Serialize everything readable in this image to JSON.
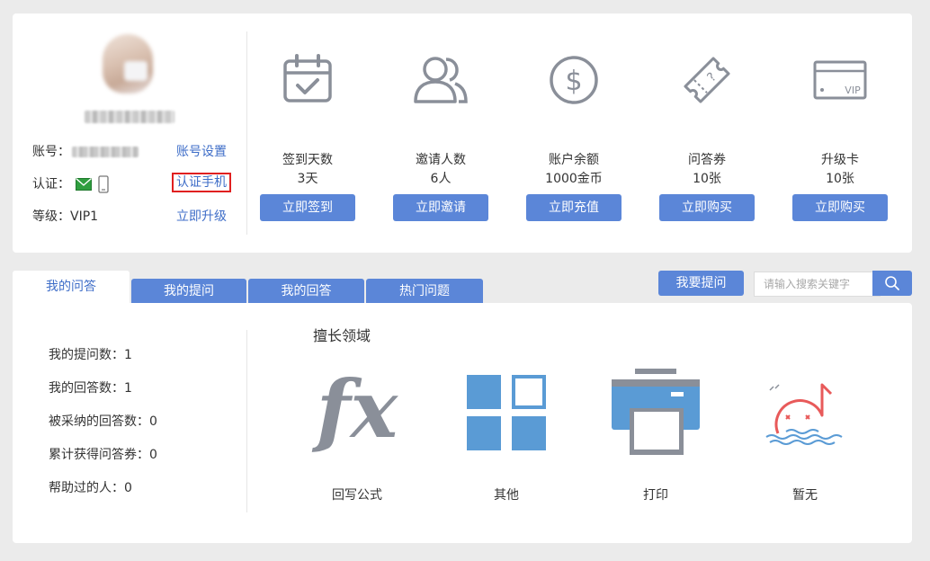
{
  "profile": {
    "account_label": "账号：",
    "verify_label": "认证：",
    "level_label": "等级：VIP1",
    "account_settings_link": "账号设置",
    "verify_phone_link": "认证手机",
    "upgrade_link": "立即升级"
  },
  "stats": [
    {
      "icon": "calendar-check-icon",
      "label": "签到天数",
      "value": "3天",
      "button": "立即签到"
    },
    {
      "icon": "users-icon",
      "label": "邀请人数",
      "value": "6人",
      "button": "立即邀请"
    },
    {
      "icon": "dollar-coin-icon",
      "label": "账户余额",
      "value": "1000金币",
      "button": "立即充值"
    },
    {
      "icon": "ticket-icon",
      "label": "问答券",
      "value": "10张",
      "button": "立即购买"
    },
    {
      "icon": "vip-card-icon",
      "label": "升级卡",
      "value": "10张",
      "button": "立即购买",
      "card_text": "VIP"
    }
  ],
  "tabs": [
    {
      "label": "我的问答",
      "active": true
    },
    {
      "label": "我的提问",
      "active": false
    },
    {
      "label": "我的回答",
      "active": false
    },
    {
      "label": "热门问题",
      "active": false
    }
  ],
  "ask_button": "我要提问",
  "search": {
    "placeholder": "请输入搜索关键字",
    "value": ""
  },
  "qa_stats": [
    "我的提问数：1",
    "我的回答数：1",
    "被采纳的回答数：0",
    "累计获得问答券：0",
    "帮助过的人：0"
  ],
  "expertise": {
    "title": "擅长领域",
    "fields": [
      {
        "icon": "formula-fx-icon",
        "label": "回写公式"
      },
      {
        "icon": "grid-tiles-icon",
        "label": "其他"
      },
      {
        "icon": "printer-icon",
        "label": "打印"
      },
      {
        "icon": "sad-music-note-icon",
        "label": "暂无"
      }
    ]
  },
  "colors": {
    "accent": "#5b86d8",
    "link": "#3f6ec8",
    "icon_gray": "#8a8f99",
    "tile_blue": "#5a9bd5",
    "highlight_red": "#e02020"
  }
}
